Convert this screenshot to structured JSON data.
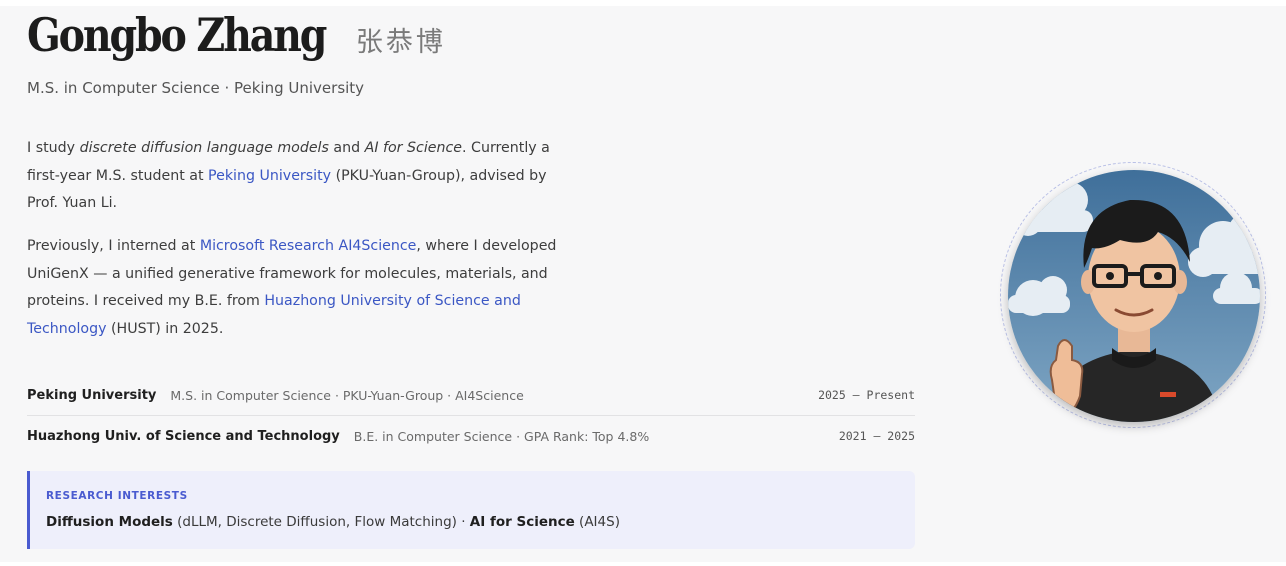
{
  "header": {
    "name": "Gongbo Zhang",
    "name_cn": "张恭博",
    "subtitle": "M.S. in Computer Science · Peking University"
  },
  "bio": {
    "p1": {
      "t1": "I study ",
      "em1": "discrete diffusion language models",
      "t2": " and ",
      "em2": "AI for Science",
      "t3": ". Currently a first-year M.S. student at ",
      "link1": "Peking University",
      "t4": " (PKU-Yuan-Group), advised by Prof. Yuan Li."
    },
    "p2": {
      "t1": "Previously, I interned at ",
      "link1": "Microsoft Research AI4Science",
      "t2": ", where I developed UniGenX — a unified generative framework for molecules, materials, and proteins. I received my B.E. from ",
      "link2": "Huazhong University of Science and Technology",
      "t3": " (HUST) in 2025."
    }
  },
  "education": [
    {
      "school": "Peking University",
      "detail": "M.S. in Computer Science · PKU-Yuan-Group · AI4Science",
      "years": "2025 – Present"
    },
    {
      "school": "Huazhong Univ. of Science and Technology",
      "detail": "B.E. in Computer Science · GPA Rank: Top 4.8%",
      "years": "2021 – 2025"
    }
  ],
  "interests": {
    "label": "RESEARCH INTERESTS",
    "b1": "Diffusion Models",
    "t1": " (dLLM, Discrete Diffusion, Flow Matching) · ",
    "b2": "AI for Science",
    "t2": " (AI4S)"
  },
  "colors": {
    "link": "#3b57c4",
    "accent": "#4a5bd0",
    "interests_bg": "#eeeffb"
  },
  "avatar": {
    "icon": "avatar-illustration"
  }
}
